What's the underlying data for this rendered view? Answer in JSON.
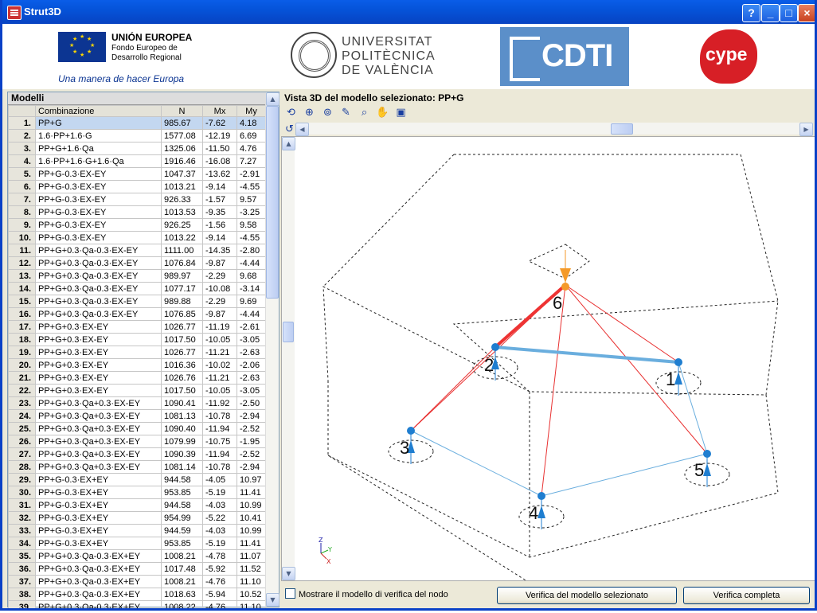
{
  "window": {
    "title": "Strut3D",
    "help_label": "?",
    "minimize_label": "_",
    "maximize_label": "□",
    "close_label": "×"
  },
  "logos": {
    "eu_title": "UNIÓN EUROPEA",
    "eu_subtitle": "Fondo Europeo de Desarrollo Regional",
    "eu_motto": "Una manera de hacer Europa",
    "upv_line1": "UNIVERSITAT",
    "upv_line2": "POLITÈCNICA",
    "upv_line3": "DE VALÈNCIA",
    "cdti": "CDTI",
    "cype": "cype"
  },
  "models": {
    "title": "Modelli",
    "columns": [
      "Combinazione",
      "N",
      "Mx",
      "My"
    ],
    "rows": [
      [
        "1.",
        "PP+G",
        "985.67",
        "-7.62",
        "4.18"
      ],
      [
        "2.",
        "1.6·PP+1.6·G",
        "1577.08",
        "-12.19",
        "6.69"
      ],
      [
        "3.",
        "PP+G+1.6·Qa",
        "1325.06",
        "-11.50",
        "4.76"
      ],
      [
        "4.",
        "1.6·PP+1.6·G+1.6·Qa",
        "1916.46",
        "-16.08",
        "7.27"
      ],
      [
        "5.",
        "PP+G-0.3·EX-EY",
        "1047.37",
        "-13.62",
        "-2.91"
      ],
      [
        "6.",
        "PP+G-0.3·EX-EY",
        "1013.21",
        "-9.14",
        "-4.55"
      ],
      [
        "7.",
        "PP+G-0.3·EX-EY",
        "926.33",
        "-1.57",
        "9.57"
      ],
      [
        "8.",
        "PP+G-0.3·EX-EY",
        "1013.53",
        "-9.35",
        "-3.25"
      ],
      [
        "9.",
        "PP+G-0.3·EX-EY",
        "926.25",
        "-1.56",
        "9.58"
      ],
      [
        "10.",
        "PP+G-0.3·EX-EY",
        "1013.22",
        "-9.14",
        "-4.55"
      ],
      [
        "11.",
        "PP+G+0.3·Qa-0.3·EX-EY",
        "1111.00",
        "-14.35",
        "-2.80"
      ],
      [
        "12.",
        "PP+G+0.3·Qa-0.3·EX-EY",
        "1076.84",
        "-9.87",
        "-4.44"
      ],
      [
        "13.",
        "PP+G+0.3·Qa-0.3·EX-EY",
        "989.97",
        "-2.29",
        "9.68"
      ],
      [
        "14.",
        "PP+G+0.3·Qa-0.3·EX-EY",
        "1077.17",
        "-10.08",
        "-3.14"
      ],
      [
        "15.",
        "PP+G+0.3·Qa-0.3·EX-EY",
        "989.88",
        "-2.29",
        "9.69"
      ],
      [
        "16.",
        "PP+G+0.3·Qa-0.3·EX-EY",
        "1076.85",
        "-9.87",
        "-4.44"
      ],
      [
        "17.",
        "PP+G+0.3·EX-EY",
        "1026.77",
        "-11.19",
        "-2.61"
      ],
      [
        "18.",
        "PP+G+0.3·EX-EY",
        "1017.50",
        "-10.05",
        "-3.05"
      ],
      [
        "19.",
        "PP+G+0.3·EX-EY",
        "1026.77",
        "-11.21",
        "-2.63"
      ],
      [
        "20.",
        "PP+G+0.3·EX-EY",
        "1016.36",
        "-10.02",
        "-2.06"
      ],
      [
        "21.",
        "PP+G+0.3·EX-EY",
        "1026.76",
        "-11.21",
        "-2.63"
      ],
      [
        "22.",
        "PP+G+0.3·EX-EY",
        "1017.50",
        "-10.05",
        "-3.05"
      ],
      [
        "23.",
        "PP+G+0.3·Qa+0.3·EX-EY",
        "1090.41",
        "-11.92",
        "-2.50"
      ],
      [
        "24.",
        "PP+G+0.3·Qa+0.3·EX-EY",
        "1081.13",
        "-10.78",
        "-2.94"
      ],
      [
        "25.",
        "PP+G+0.3·Qa+0.3·EX-EY",
        "1090.40",
        "-11.94",
        "-2.52"
      ],
      [
        "26.",
        "PP+G+0.3·Qa+0.3·EX-EY",
        "1079.99",
        "-10.75",
        "-1.95"
      ],
      [
        "27.",
        "PP+G+0.3·Qa+0.3·EX-EY",
        "1090.39",
        "-11.94",
        "-2.52"
      ],
      [
        "28.",
        "PP+G+0.3·Qa+0.3·EX-EY",
        "1081.14",
        "-10.78",
        "-2.94"
      ],
      [
        "29.",
        "PP+G-0.3·EX+EY",
        "944.58",
        "-4.05",
        "10.97"
      ],
      [
        "30.",
        "PP+G-0.3·EX+EY",
        "953.85",
        "-5.19",
        "11.41"
      ],
      [
        "31.",
        "PP+G-0.3·EX+EY",
        "944.58",
        "-4.03",
        "10.99"
      ],
      [
        "32.",
        "PP+G-0.3·EX+EY",
        "954.99",
        "-5.22",
        "10.41"
      ],
      [
        "33.",
        "PP+G-0.3·EX+EY",
        "944.59",
        "-4.03",
        "10.99"
      ],
      [
        "34.",
        "PP+G-0.3·EX+EY",
        "953.85",
        "-5.19",
        "11.41"
      ],
      [
        "35.",
        "PP+G+0.3·Qa-0.3·EX+EY",
        "1008.21",
        "-4.78",
        "11.07"
      ],
      [
        "36.",
        "PP+G+0.3·Qa-0.3·EX+EY",
        "1017.48",
        "-5.92",
        "11.52"
      ],
      [
        "37.",
        "PP+G+0.3·Qa-0.3·EX+EY",
        "1008.21",
        "-4.76",
        "11.10"
      ],
      [
        "38.",
        "PP+G+0.3·Qa-0.3·EX+EY",
        "1018.63",
        "-5.94",
        "10.52"
      ],
      [
        "39.",
        "PP+G+0.3·Qa-0.3·EX+EY",
        "1008.22",
        "-4.76",
        "11.10"
      ]
    ]
  },
  "view": {
    "title": "Vista 3D del modello selezionato: PP+G",
    "tools": [
      {
        "name": "rotate-icon",
        "glyph": "⟲"
      },
      {
        "name": "zoom-window-icon",
        "glyph": "⊕"
      },
      {
        "name": "zoom-extents-icon",
        "glyph": "⊚"
      },
      {
        "name": "draw-icon",
        "glyph": "✎"
      },
      {
        "name": "zoom-icon",
        "glyph": "⌕"
      },
      {
        "name": "pan-hand-icon",
        "glyph": "✋"
      },
      {
        "name": "copy-view-icon",
        "glyph": "▣"
      }
    ],
    "node_labels": [
      "1",
      "2",
      "3",
      "4",
      "5",
      "6"
    ],
    "axes": {
      "x": "X",
      "y": "Y",
      "z": "Z"
    },
    "colors": {
      "tie": "#e83030",
      "tie_heavy": "#ee3333",
      "strut": "#6aaede",
      "node": "#1f7ed0",
      "load": "#f49a2a"
    }
  },
  "footer": {
    "checkbox_label": "Mostrare il modello di verifica del nodo",
    "verify_selected_label": "Verifica del modello selezionato",
    "verify_all_label": "Verifica completa"
  }
}
